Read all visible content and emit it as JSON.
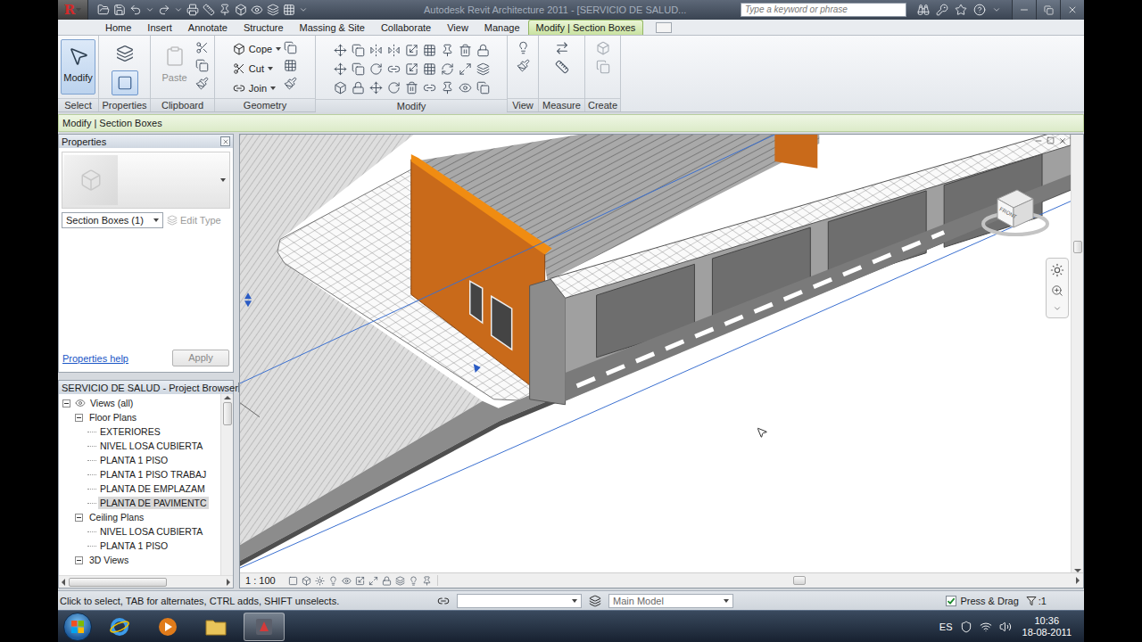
{
  "window": {
    "logo": "R",
    "title": "Autodesk Revit Architecture 2011 - [SERVICIO DE SALUD...",
    "search_placeholder": "Type a keyword or phrase"
  },
  "tabs": [
    {
      "label": "Home",
      "selected": false
    },
    {
      "label": "Insert",
      "selected": false
    },
    {
      "label": "Annotate",
      "selected": false
    },
    {
      "label": "Structure",
      "selected": false
    },
    {
      "label": "Massing & Site",
      "selected": false
    },
    {
      "label": "Collaborate",
      "selected": false
    },
    {
      "label": "View",
      "selected": false
    },
    {
      "label": "Manage",
      "selected": false
    },
    {
      "label": "Modify | Section Boxes",
      "selected": true
    }
  ],
  "ribbon": [
    {
      "label": "Select",
      "kind": "select",
      "disabled": false,
      "highlight": false,
      "buttons": [
        {
          "label": "Modify",
          "selected": true,
          "disabled": false,
          "dropdown": false
        }
      ]
    },
    {
      "label": "Properties",
      "kind": "properties",
      "disabled": false,
      "highlight": true,
      "buttons": []
    },
    {
      "label": "Clipboard",
      "kind": "clipboard",
      "disabled": false,
      "highlight": false,
      "buttons": [
        {
          "label": "Paste",
          "selected": false,
          "disabled": true,
          "dropdown": false
        }
      ]
    },
    {
      "label": "Geometry",
      "kind": "geometry",
      "disabled": false,
      "highlight": false,
      "buttons": [
        {
          "label": "Cope",
          "selected": false,
          "disabled": false,
          "dropdown": true
        },
        {
          "label": "Cut",
          "selected": false,
          "disabled": false,
          "dropdown": true
        },
        {
          "label": "Join",
          "selected": false,
          "disabled": false,
          "dropdown": true
        }
      ]
    },
    {
      "label": "Modify",
      "kind": "modify",
      "disabled": false,
      "highlight": false,
      "buttons": []
    },
    {
      "label": "View",
      "kind": "view",
      "disabled": false,
      "highlight": false,
      "buttons": []
    },
    {
      "label": "Measure",
      "kind": "measure",
      "disabled": false,
      "highlight": false,
      "buttons": []
    },
    {
      "label": "Create",
      "kind": "create",
      "disabled": true,
      "highlight": false,
      "buttons": []
    }
  ],
  "context_bar": "Modify | Section Boxes",
  "properties": {
    "title": "Properties",
    "type_selector": "Section Boxes (1)",
    "edit_type": "Edit Type",
    "edit_type_disabled": true,
    "help": "Properties help",
    "apply": "Apply",
    "apply_disabled": true
  },
  "project_browser": {
    "title": "SERVICIO DE SALUD - Project Browser",
    "items": [
      {
        "label": "Views (all)",
        "depth": 0,
        "kind": "root",
        "expanded": true,
        "selected": false
      },
      {
        "label": "Floor Plans",
        "depth": 1,
        "kind": "group",
        "expanded": true,
        "selected": false
      },
      {
        "label": "EXTERIORES",
        "depth": 2,
        "kind": "view",
        "expanded": false,
        "selected": false
      },
      {
        "label": "NIVEL LOSA CUBIERTA",
        "depth": 2,
        "kind": "view",
        "expanded": false,
        "selected": false
      },
      {
        "label": "PLANTA 1 PISO",
        "depth": 2,
        "kind": "view",
        "expanded": false,
        "selected": false
      },
      {
        "label": "PLANTA 1 PISO TRABAJ",
        "depth": 2,
        "kind": "view",
        "expanded": false,
        "selected": false
      },
      {
        "label": "PLANTA DE EMPLAZAM",
        "depth": 2,
        "kind": "view",
        "expanded": false,
        "selected": false
      },
      {
        "label": "PLANTA DE PAVIMENTC",
        "depth": 2,
        "kind": "view",
        "expanded": false,
        "selected": true
      },
      {
        "label": "Ceiling Plans",
        "depth": 1,
        "kind": "group",
        "expanded": true,
        "selected": false
      },
      {
        "label": "NIVEL LOSA CUBIERTA",
        "depth": 2,
        "kind": "view",
        "expanded": false,
        "selected": false
      },
      {
        "label": "PLANTA 1 PISO",
        "depth": 2,
        "kind": "view",
        "expanded": false,
        "selected": false
      },
      {
        "label": "3D Views",
        "depth": 1,
        "kind": "group",
        "expanded": true,
        "selected": false
      }
    ]
  },
  "view": {
    "scale": "1 : 100",
    "viewcube": "FRONT"
  },
  "status_bar": {
    "hint": "Click to select, TAB for alternates, CTRL adds, SHIFT unselects.",
    "model": "Main Model",
    "press_drag": {
      "label": "Press & Drag",
      "checked": true
    },
    "filter": ":1"
  },
  "taskbar": {
    "language": "ES",
    "time": "10:36",
    "date": "18-08-2011"
  }
}
